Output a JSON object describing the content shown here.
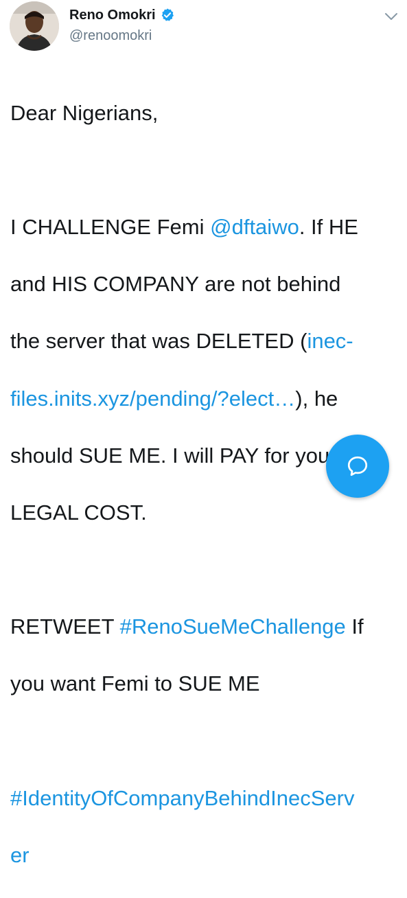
{
  "author": {
    "display_name": "Reno Omokri",
    "handle": "@renoomokri",
    "verified": true
  },
  "icons": {
    "avatar": "profile-photo",
    "verified": "verified-badge-icon",
    "menu": "chevron-down-icon",
    "compose": "chat-bubble-icon"
  },
  "colors": {
    "link": "#1b95e0",
    "fab": "#1da1f2",
    "handle": "#657786"
  },
  "tweet": {
    "greeting": "Dear Nigerians,",
    "l1_pre": "I CHALLENGE Femi ",
    "l1_mention": "@dftaiwo",
    "l1_post": ". If HE",
    "l2": "and HIS COMPANY are not behind",
    "l3_pre": "the server that was DELETED (",
    "l3_link": "inec-",
    "l4_link": "files.inits.xyz/pending/?elect…",
    "l4_post": "), he",
    "l5": "should SUE ME. I will PAY for your",
    "l6": "LEGAL COST.",
    "l7_pre": "RETWEET ",
    "l7_hashtag": "#RenoSueMeChallenge",
    "l7_post": " If",
    "l8": "you want Femi to SUE ME",
    "l9_hashtag": "#IdentityOfCompanyBehindInecServ",
    "l10_hashtag": "er"
  }
}
